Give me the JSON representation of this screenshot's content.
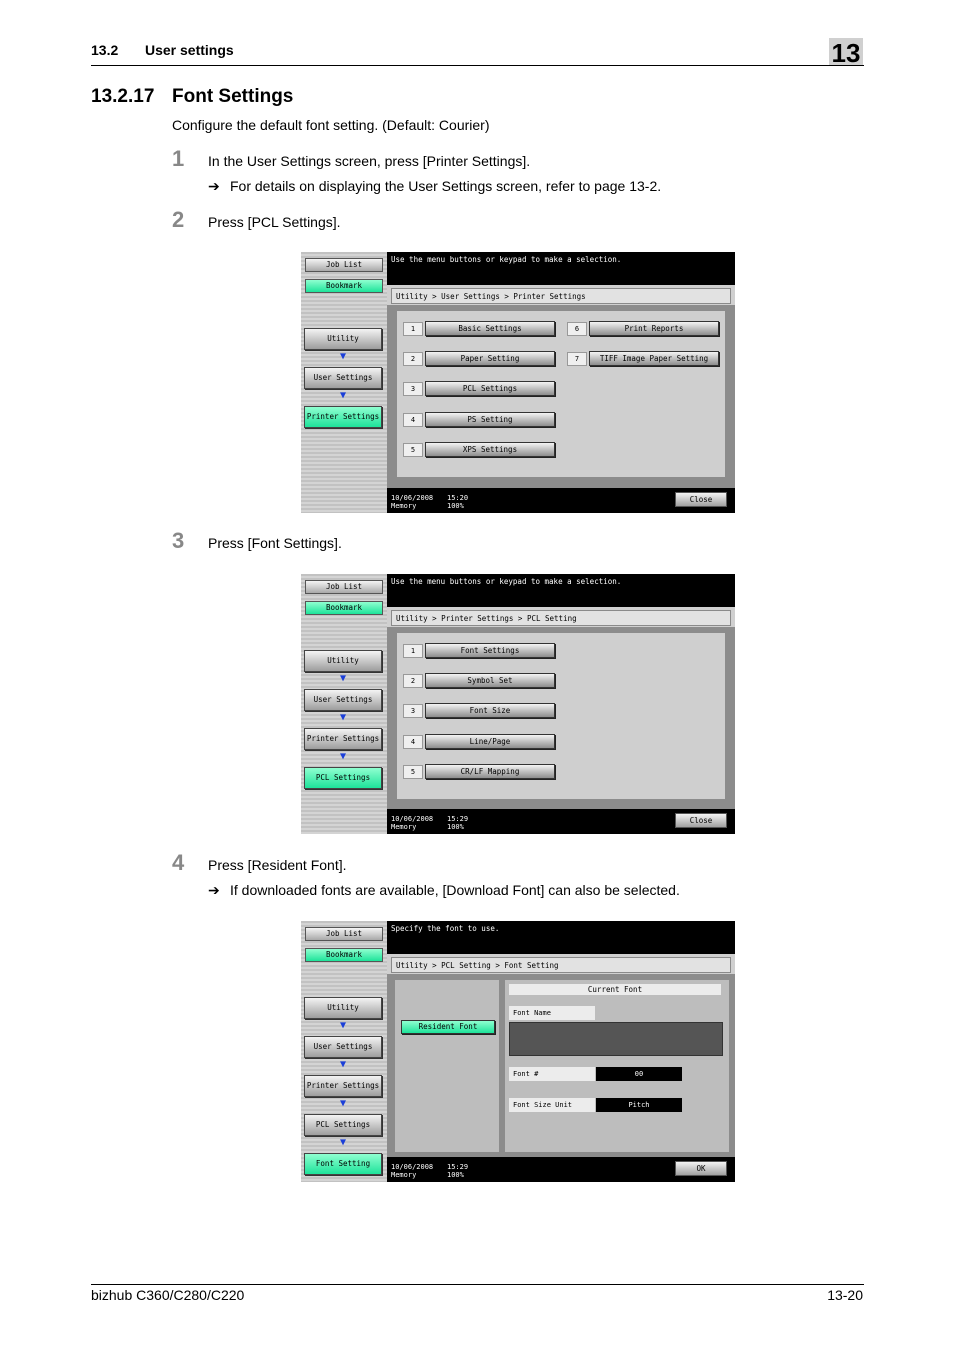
{
  "header": {
    "section_number": "13.2",
    "section_title": "User settings",
    "chapter": "13"
  },
  "heading": {
    "number": "13.2.17",
    "title": "Font Settings"
  },
  "intro": "Configure the default font setting. (Default: Courier)",
  "steps": [
    {
      "num": "1",
      "text": "In the User Settings screen, press [Printer Settings].",
      "bullet": "For details on displaying the User Settings screen, refer to page 13-2."
    },
    {
      "num": "2",
      "text": "Press [PCL Settings]."
    },
    {
      "num": "3",
      "text": "Press [Font Settings]."
    },
    {
      "num": "4",
      "text": "Press [Resident Font].",
      "bullet": "If downloaded fonts are available, [Download Font] can also be selected."
    }
  ],
  "bullet_arrow": "➔",
  "screens": {
    "common": {
      "job_list": "Job List",
      "bookmark": "Bookmark",
      "utility": "Utility",
      "user_settings": "User Settings",
      "printer_settings": "Printer Settings",
      "pcl_settings": "PCL Settings",
      "font_setting": "Font Setting",
      "date": "10/06/2008",
      "memory": "Memory",
      "memory_pct": "100%",
      "close": "Close",
      "ok": "OK"
    },
    "s1": {
      "message": "Use the menu buttons or keypad to make a selection.",
      "crumb": "Utility > User Settings > Printer Settings",
      "time": "15:20",
      "items": [
        {
          "n": "1",
          "label": "Basic Settings"
        },
        {
          "n": "2",
          "label": "Paper Setting"
        },
        {
          "n": "3",
          "label": "PCL Settings"
        },
        {
          "n": "4",
          "label": "PS Setting"
        },
        {
          "n": "5",
          "label": "XPS Settings"
        },
        {
          "n": "6",
          "label": "Print Reports"
        },
        {
          "n": "7",
          "label": "TIFF Image Paper Setting"
        }
      ]
    },
    "s2": {
      "message": "Use the menu buttons or keypad to make a selection.",
      "crumb": "Utility > Printer Settings > PCL Setting",
      "time": "15:29",
      "items": [
        {
          "n": "1",
          "label": "Font Settings"
        },
        {
          "n": "2",
          "label": "Symbol Set"
        },
        {
          "n": "3",
          "label": "Font Size"
        },
        {
          "n": "4",
          "label": "Line/Page"
        },
        {
          "n": "5",
          "label": "CR/LF Mapping"
        }
      ]
    },
    "s3": {
      "message": "Specify the font to use.",
      "crumb": "Utility > PCL Setting > Font Setting",
      "time": "15:29",
      "resident_font": "Resident Font",
      "current_font": "Current Font",
      "font_name_label": "Font Name",
      "font_num_label": "Font #",
      "font_num_value": "00",
      "size_unit_label": "Font Size Unit",
      "size_unit_value": "Pitch"
    }
  },
  "footer": {
    "model": "bizhub C360/C280/C220",
    "page": "13-20"
  }
}
